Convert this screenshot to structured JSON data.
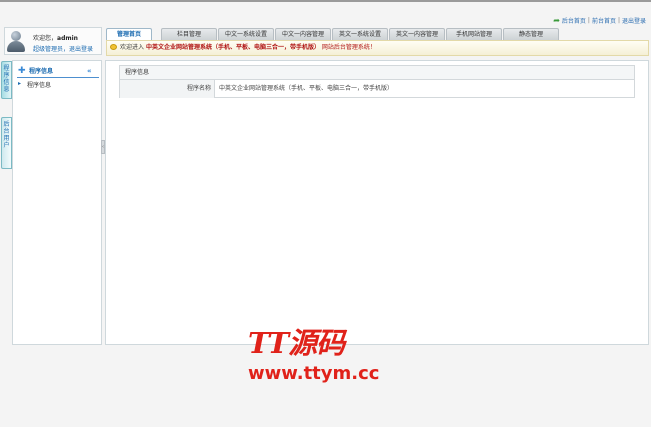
{
  "top_links": {
    "backend_home": "后台首页",
    "sep": "|",
    "frontend_home": "前台首页",
    "logout": "退出登录"
  },
  "user": {
    "welcome_prefix": "欢迎您，",
    "username": "admin",
    "role_links": "超级管理员，退出登录"
  },
  "tabs": [
    {
      "label": "管理首页",
      "active": true
    },
    {
      "label": "栏目管理"
    },
    {
      "label": "中文一系统设置"
    },
    {
      "label": "中文一内容管理"
    },
    {
      "label": "英文一系统设置"
    },
    {
      "label": "英文一内容管理"
    },
    {
      "label": "手机网站管理"
    },
    {
      "label": "静态管理"
    }
  ],
  "welcome_bar": {
    "pre": "欢迎进入",
    "system_name": "中英文企业网站管理系统（手机、平板、电脑三合一，带手机版）",
    "post": "网站后台管理系统！"
  },
  "vertical_tabs": [
    {
      "chars": [
        "程",
        "序",
        "信",
        "息"
      ]
    },
    {
      "chars": [
        "后",
        "台",
        "用",
        "户"
      ]
    }
  ],
  "sidebar": {
    "header": "程序信息",
    "collapse_glyph": "«",
    "items": [
      {
        "label": "程序信息"
      }
    ]
  },
  "main": {
    "panel_title": "程序信息",
    "rows": [
      {
        "label": "程序名称",
        "value": "中英文企业网站管理系统（手机、平板、电脑三合一，带手机版）"
      }
    ]
  },
  "watermark": {
    "logo": "TT源码",
    "url": "www.ttym.cc"
  },
  "colors": {
    "link": "#1a6ab0",
    "system_name_red": "#b01414",
    "watermark_red": "#e0221a",
    "vtab_cyan": "#a7dde4"
  }
}
